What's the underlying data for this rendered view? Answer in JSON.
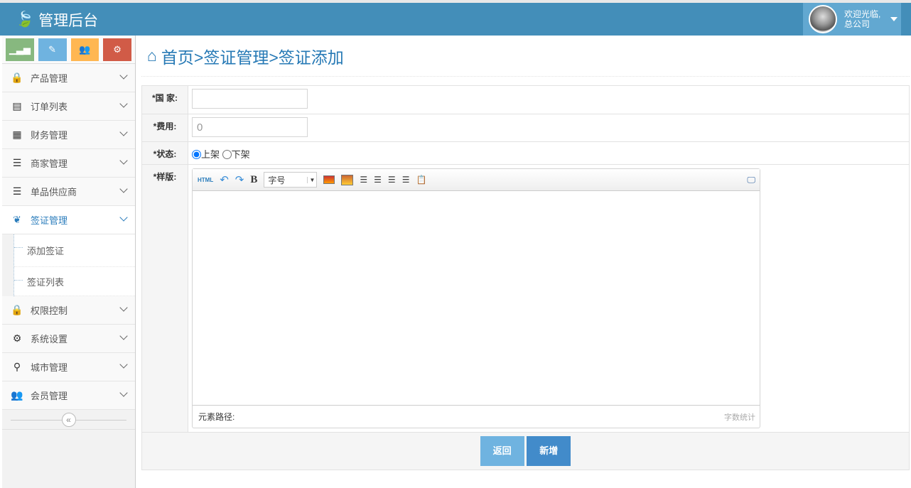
{
  "header": {
    "brand": "管理后台",
    "welcome": "欢迎光临,",
    "user": "总公司"
  },
  "shortcuts": [
    {
      "name": "stats",
      "color": "#87b87f",
      "icon": "▁▃▅"
    },
    {
      "name": "edit",
      "color": "#6fb3e0",
      "icon": "✎"
    },
    {
      "name": "users",
      "color": "#ffb752",
      "icon": "👥"
    },
    {
      "name": "settings",
      "color": "#d15b47",
      "icon": "⚙"
    }
  ],
  "sidebar": {
    "items": [
      {
        "label": "产品管理",
        "icon": "🔒"
      },
      {
        "label": "订单列表",
        "icon": "▤"
      },
      {
        "label": "财务管理",
        "icon": "▦"
      },
      {
        "label": "商家管理",
        "icon": "☰"
      },
      {
        "label": "单品供应商",
        "icon": "☰"
      },
      {
        "label": "签证管理",
        "icon": "❦"
      },
      {
        "label": "权限控制",
        "icon": "🔒"
      },
      {
        "label": "系统设置",
        "icon": "⚙"
      },
      {
        "label": "城市管理",
        "icon": "⚲"
      },
      {
        "label": "会员管理",
        "icon": "👥"
      }
    ],
    "sub": [
      "添加签证",
      "签证列表"
    ],
    "collapse": "«"
  },
  "page": {
    "breadcrumb": "首页>签证管理>签证添加"
  },
  "form": {
    "country_label": "*国 家:",
    "country_value": "",
    "fee_label": "*费用:",
    "fee_value": "0",
    "status_label": "*状态:",
    "status_on": "上架",
    "status_off": "下架",
    "template_label": "*样版:",
    "editor": {
      "html": "HTML",
      "font_size": "字号",
      "path": "元素路径:",
      "count": "字数统计"
    },
    "back": "返回",
    "add": "新增"
  }
}
